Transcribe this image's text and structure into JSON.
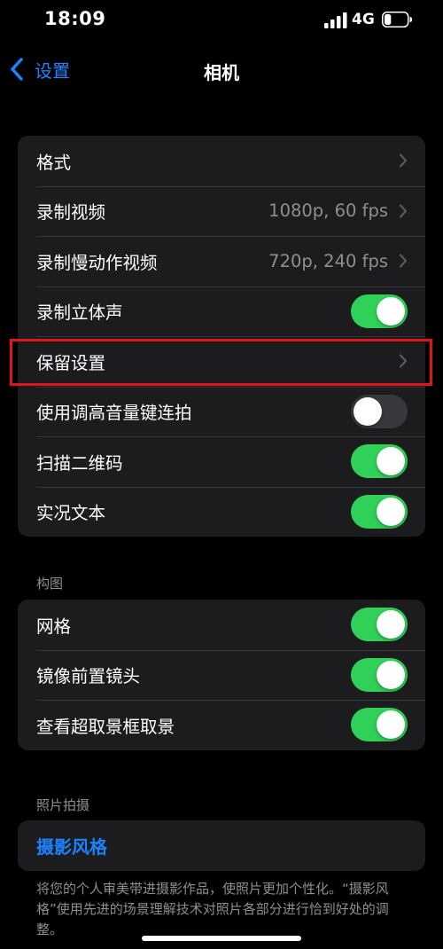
{
  "status_bar": {
    "time": "18:09",
    "network": "4G",
    "battery_level": 0.3
  },
  "nav": {
    "back_label": "设置",
    "title": "相机"
  },
  "group1": {
    "rows": [
      {
        "label": "格式",
        "value": ""
      },
      {
        "label": "录制视频",
        "value": "1080p, 60 fps"
      },
      {
        "label": "录制慢动作视频",
        "value": "720p, 240 fps"
      },
      {
        "label": "录制立体声",
        "toggle": true
      },
      {
        "label": "保留设置",
        "value": ""
      },
      {
        "label": "使用调高音量键连拍",
        "toggle": false
      },
      {
        "label": "扫描二维码",
        "toggle": true
      },
      {
        "label": "实况文本",
        "toggle": true
      }
    ]
  },
  "composition": {
    "header": "构图",
    "rows": [
      {
        "label": "网格",
        "toggle": true
      },
      {
        "label": "镜像前置镜头",
        "toggle": true
      },
      {
        "label": "查看超取景框取景",
        "toggle": true
      }
    ]
  },
  "photo_capture": {
    "header": "照片拍摄",
    "link_label": "摄影风格",
    "footer": "将您的个人审美带进摄影作品，使照片更加个性化。“摄影风格”使用先进的场景理解技术对照片各部分进行恰到好处的调整。"
  },
  "colors": {
    "accent": "#1a84ff",
    "toggle_on": "#30d158",
    "highlight": "#e0141c"
  }
}
